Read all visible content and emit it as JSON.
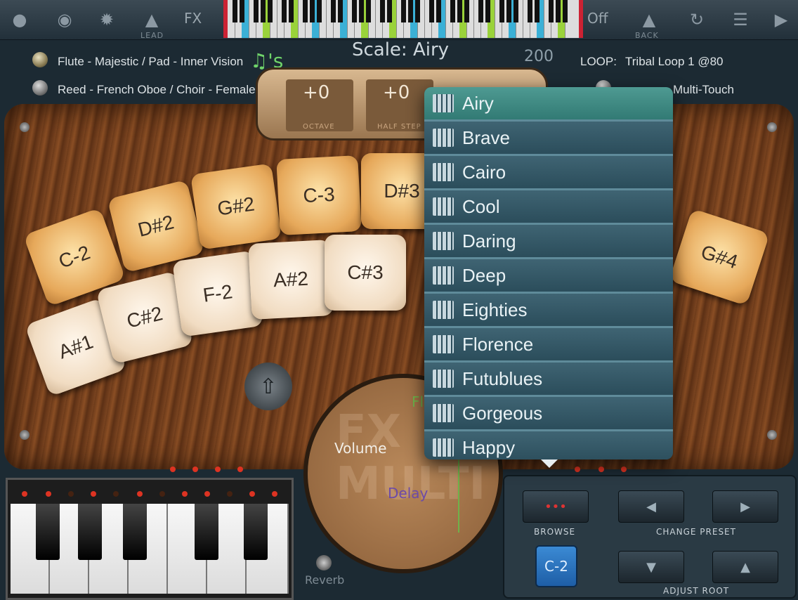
{
  "topbar": {
    "fx_label": "FX",
    "lead_label": "LEAD",
    "off_label": "Off",
    "back_label": "BACK"
  },
  "instruments": [
    {
      "label": "Flute - Majestic / Pad - Inner Vision",
      "selected": true
    },
    {
      "label": "Reed - French Oboe / Choir - Female",
      "selected": false
    }
  ],
  "scale_title": "Scale: Airy",
  "notes_icon": "♫'s",
  "tempo": "200",
  "loop": {
    "label": "LOOP:",
    "value": "Tribal Loop 1 @80"
  },
  "mode_text": "Multi-Touch",
  "transpose": {
    "octave": {
      "value": "+0",
      "label": "OCTAVE"
    },
    "half_step": {
      "value": "+0",
      "label": "HALF STEP"
    }
  },
  "pads": [
    {
      "note": "C-2",
      "style": "or"
    },
    {
      "note": "D#2",
      "style": "or"
    },
    {
      "note": "G#2",
      "style": "or"
    },
    {
      "note": "C-3",
      "style": "or"
    },
    {
      "note": "D#3",
      "style": "or"
    },
    {
      "note": "G#4",
      "style": "or"
    },
    {
      "note": "A#1",
      "style": "wh"
    },
    {
      "note": "C#2",
      "style": "wh"
    },
    {
      "note": "F-2",
      "style": "wh"
    },
    {
      "note": "A#2",
      "style": "wh"
    },
    {
      "note": "C#3",
      "style": "wh"
    }
  ],
  "dial": {
    "volume_label": "Volume",
    "delay_label": "Delay",
    "fi_label": "Fl",
    "watermark": "FX MULTI"
  },
  "reverb_label": "Reverb",
  "controls": {
    "browse_label": "BROWSE",
    "change_preset_label": "CHANGE PRESET",
    "adjust_root_label": "ADJUST ROOT",
    "root_value": "C-2"
  },
  "scale_menu": {
    "items": [
      "Airy",
      "Brave",
      "Cairo",
      "Cool",
      "Daring",
      "Deep",
      "Eighties",
      "Florence",
      "Futublues",
      "Gorgeous",
      "Happy"
    ],
    "selected": "Airy"
  },
  "colors": {
    "accent": "#327a74",
    "root_button": "#1e5ea6",
    "led": "#dd3322"
  }
}
